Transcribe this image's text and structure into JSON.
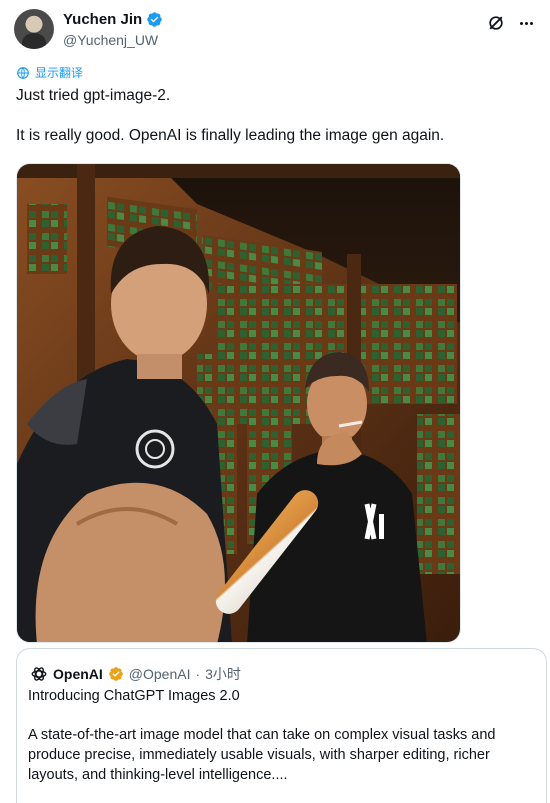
{
  "author": {
    "name": "Yuchen Jin",
    "handle": "@Yuchenj_UW",
    "verified_color": "#1d9bf0"
  },
  "actions": {
    "grok_icon": "grok-icon",
    "more_icon": "more-icon"
  },
  "translate": {
    "label": "显示翻译",
    "icon": "globe-icon"
  },
  "tweet": {
    "line1": "Just tried gpt-image-2.",
    "line2": "It is really good. OpenAI is finally leading the image gen again."
  },
  "media": {
    "logo_text": "xI"
  },
  "quote": {
    "author_name": "OpenAI",
    "author_handle": "@OpenAI",
    "separator": "·",
    "time": "3小时",
    "badge_color": "#e8a317",
    "title": "Introducing ChatGPT Images 2.0",
    "body": "A state-of-the-art image model that can take on complex visual tasks and produce precise, immediately usable visuals, with sharper editing, richer layouts, and thinking-level intelligence...."
  },
  "colors": {
    "link": "#1d9bf0",
    "muted": "#536471",
    "text": "#0f1419",
    "border": "#cfd9de"
  }
}
